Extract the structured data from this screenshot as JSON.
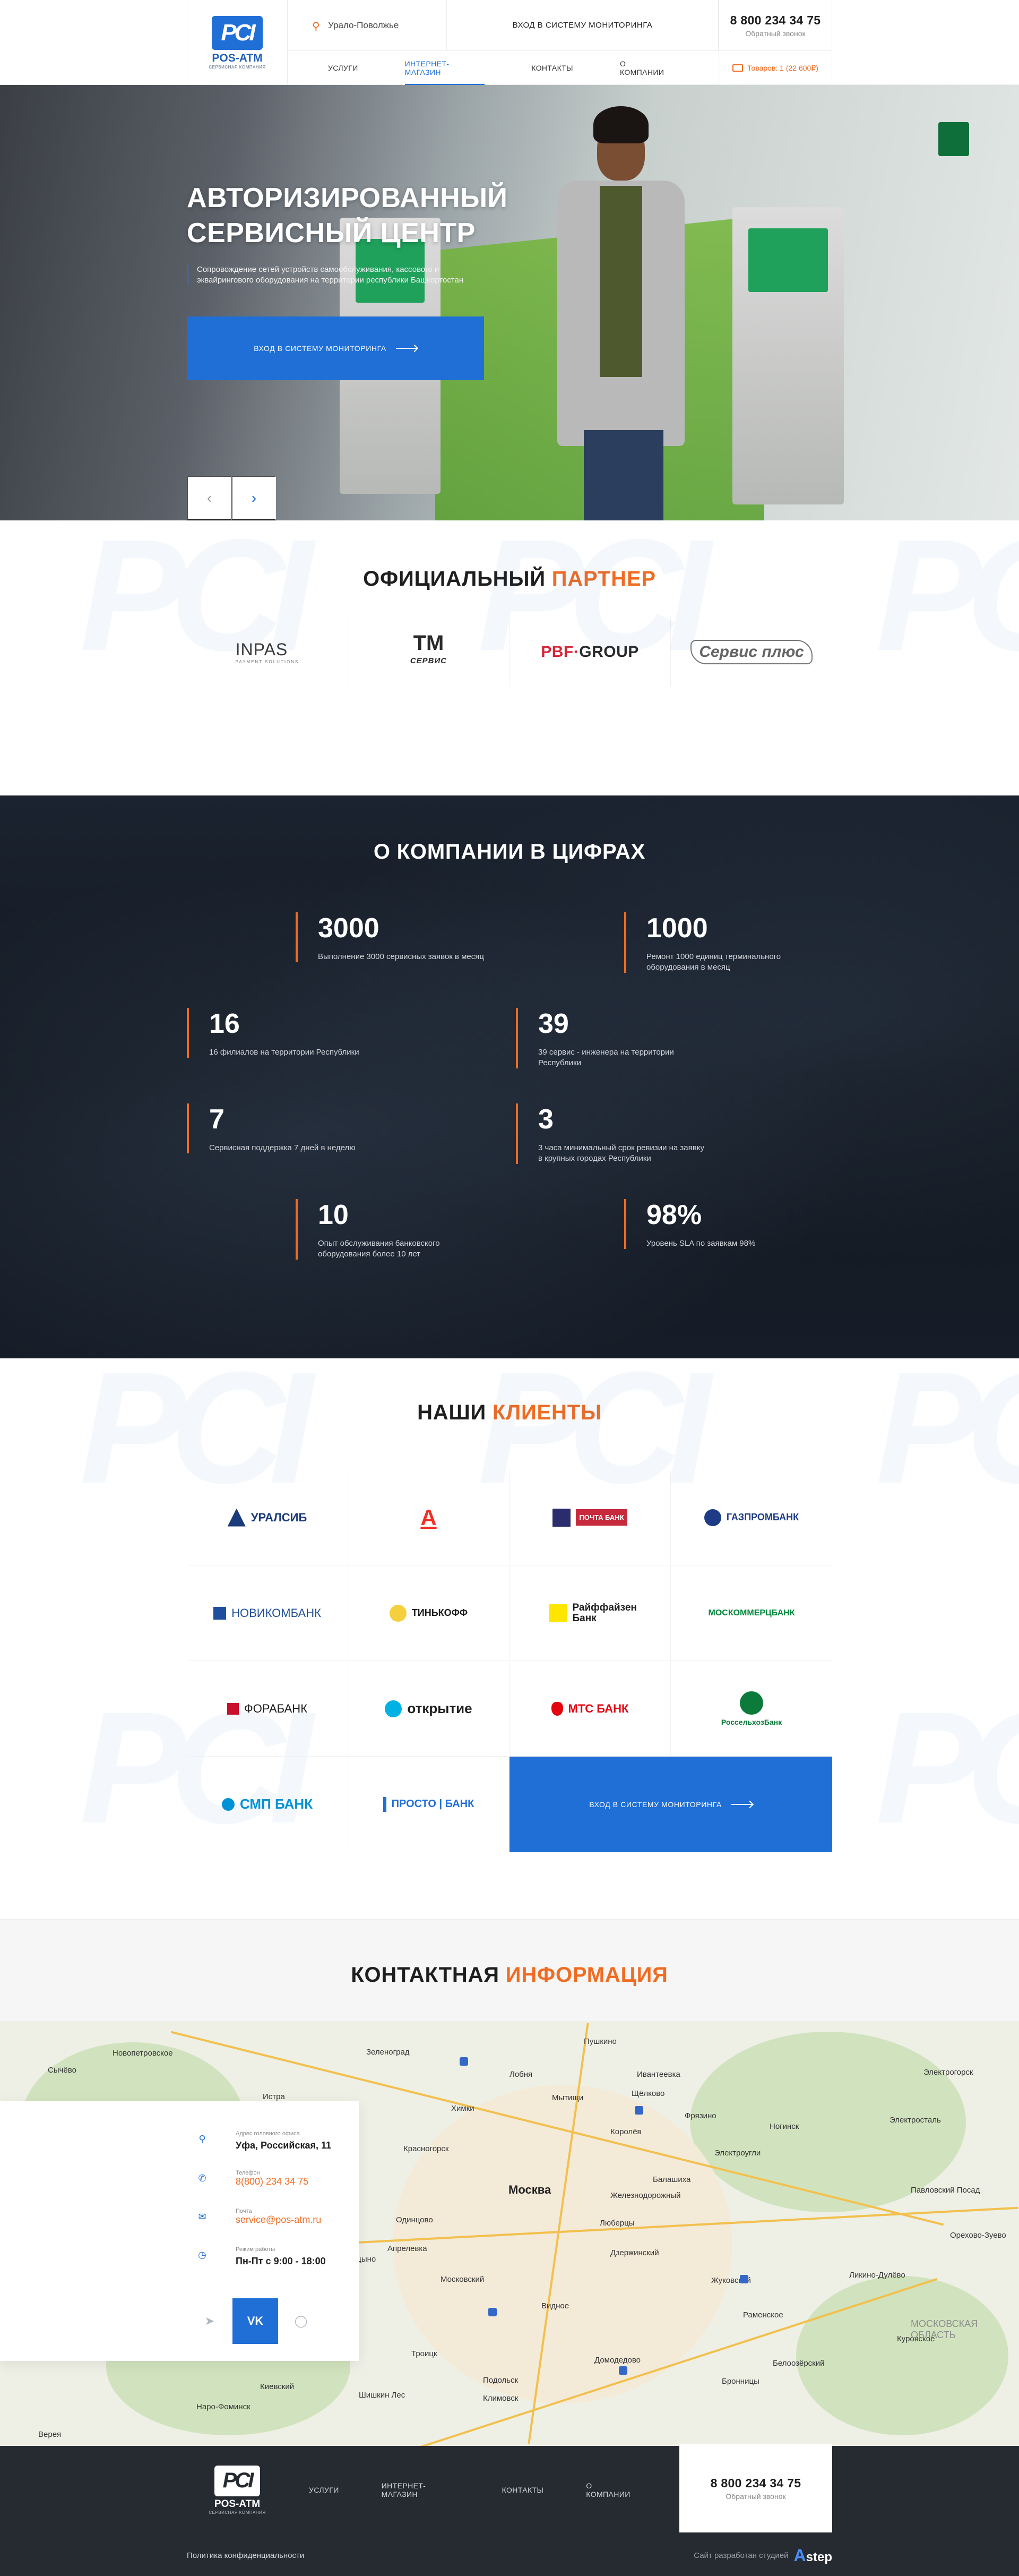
{
  "brand": {
    "name": "POS-ATM",
    "tagline": "СЕРВИСНАЯ КОМПАНИЯ"
  },
  "header": {
    "region": "Урало-Поволжье",
    "monitor_link": "ВХОД В СИСТЕМУ МОНИТОРИНГА",
    "phone": "8 800 234 34 75",
    "callback": "Обратный звонок",
    "cart": "Товаров: 1 (22 600₽)",
    "nav": [
      "УСЛУГИ",
      "ИНТЕРНЕТ-МАГАЗИН",
      "КОНТАКТЫ",
      "О КОМПАНИИ"
    ],
    "active_nav": "ИНТЕРНЕТ-МАГАЗИН"
  },
  "hero": {
    "title_line1": "АВТОРИЗИРОВАННЫЙ",
    "title_line2": "СЕРВИСНЫЙ ЦЕНТР",
    "description": "Сопровождение сетей устройств самообслуживания, кассового и эквайрингового оборудования на территории республики Башкортостан",
    "button": "ВХОД В СИСТЕМУ МОНИТОРИНГА",
    "prev_icon": "chevron-left-icon",
    "next_icon": "chevron-right-icon"
  },
  "partners": {
    "title_main": "ОФИЦИАЛЬНЫЙ",
    "title_accent": "ПАРТНЕР",
    "logos": {
      "inpas": "INPAS",
      "inpas_sub": "PAYMENT SOLUTIONS",
      "tm": "TM",
      "tm_sub": "СЕРВИС",
      "pbf_a": "PBF",
      "pbf_b": "GROUP",
      "servis": "Сервис плюс"
    }
  },
  "stats": {
    "title": "О КОМПАНИИ В ЦИФРАХ",
    "items": [
      {
        "num": "3000",
        "label": "Выполнение 3000 сервисных заявок в месяц"
      },
      {
        "num": "1000",
        "label": "Ремонт 1000 единиц терминального оборудования в месяц"
      },
      {
        "num": "16",
        "label": "16 филиалов на территории Республики"
      },
      {
        "num": "39",
        "label": "39 сервис - инженера на территории Республики"
      },
      {
        "num": "7",
        "label": "Сервисная поддержка 7 дней в неделю"
      },
      {
        "num": "3",
        "label": "3 часа минимальный срок ревизии на заявку в крупных городах Республики"
      },
      {
        "num": "10",
        "label": "Опыт обслуживания банковского оборудования более 10 лет"
      },
      {
        "num": "98%",
        "label": "Уровень SLA по заявкам 98%"
      }
    ]
  },
  "clients": {
    "title_main": "НАШИ",
    "title_accent": "КЛИЕНТЫ",
    "logos": [
      {
        "name": "УРАЛСИБ",
        "color": "#1a3a7a"
      },
      {
        "name": "А",
        "color": "#ef3124"
      },
      {
        "name": "ПОЧТА БАНК",
        "color": "#2b2c6e"
      },
      {
        "name": "ГАЗПРОМБАНК",
        "color": "#1d3c85"
      },
      {
        "name": "НОВИКОМБАНК",
        "color": "#1f4f9c"
      },
      {
        "name": "ТИНЬКОФФ",
        "color": "#1e1e1e"
      },
      {
        "name": "Райффайзен Банк",
        "color": "#1e1e1e"
      },
      {
        "name": "МОСКОММЕРЦБАНК",
        "color": "#00873c"
      },
      {
        "name": "ФОРАБАНК",
        "color": "#1e1e1e"
      },
      {
        "name": "открытие",
        "color": "#1e1e1e"
      },
      {
        "name": "МТС БАНК",
        "color": "#e30611"
      },
      {
        "name": "РоссельхозБанк",
        "color": "#0b7a3b"
      },
      {
        "name": "СМП БАНК",
        "color": "#0092d6"
      },
      {
        "name": "ПРОСТО | БАНК",
        "color": "#1f6fd6"
      }
    ],
    "cta": "ВХОД В СИСТЕМУ МОНИТОРИНГА"
  },
  "contacts": {
    "title_main": "КОНТАКТНАЯ",
    "title_accent": "ИНФОРМАЦИЯ",
    "address_label": "Адрес головного офиса",
    "address": "Уфа, Российская, 11",
    "phone_label": "Телефон",
    "phone": "8(800) 234 34 75",
    "email_label": "Почта",
    "email": "service@pos-atm.ru",
    "hours_label": "Режим работы",
    "hours": "Пн-Пт с 9:00 - 18:00",
    "social_vk": "VK"
  },
  "map": {
    "labels": [
      "Зеленоград",
      "Пушкино",
      "Щёлково",
      "Химки",
      "Мытищи",
      "Красногорск",
      "Балашиха",
      "Москва",
      "Железнодорожный",
      "Люберцы",
      "Одинцово",
      "Жуковский",
      "Видное",
      "Подольск",
      "Домодедово",
      "Раменское",
      "Ногинск",
      "Электросталь",
      "Истра",
      "Новопетровское",
      "Сычёво",
      "Павловский Посад",
      "Орехово-Зуево",
      "Наро-Фоминск",
      "Климовск",
      "Троицк",
      "Московский",
      "Киевский",
      "Бронницы",
      "Белоозёрский",
      "Электрогорск",
      "Верея",
      "Куровское",
      "Электроугли",
      "МОСКОВСКАЯ ОБЛАСТЬ",
      "Ликино-Дулёво",
      "Шишкин Лес",
      "Дзержинский",
      "Апрелевка",
      "Голицыно",
      "Лобня",
      "Королёв",
      "Фрязино",
      "Ивантеевка"
    ]
  },
  "footer": {
    "nav": [
      "УСЛУГИ",
      "ИНТЕРНЕТ-МАГАЗИН",
      "КОНТАКТЫ",
      "О КОМПАНИИ"
    ],
    "phone": "8 800 234 34 75",
    "callback": "Обратный звонок",
    "privacy": "Политика конфиденциальности",
    "dev_label": "Сайт разработан студией",
    "dev_a": "A",
    "dev_name": "step"
  }
}
